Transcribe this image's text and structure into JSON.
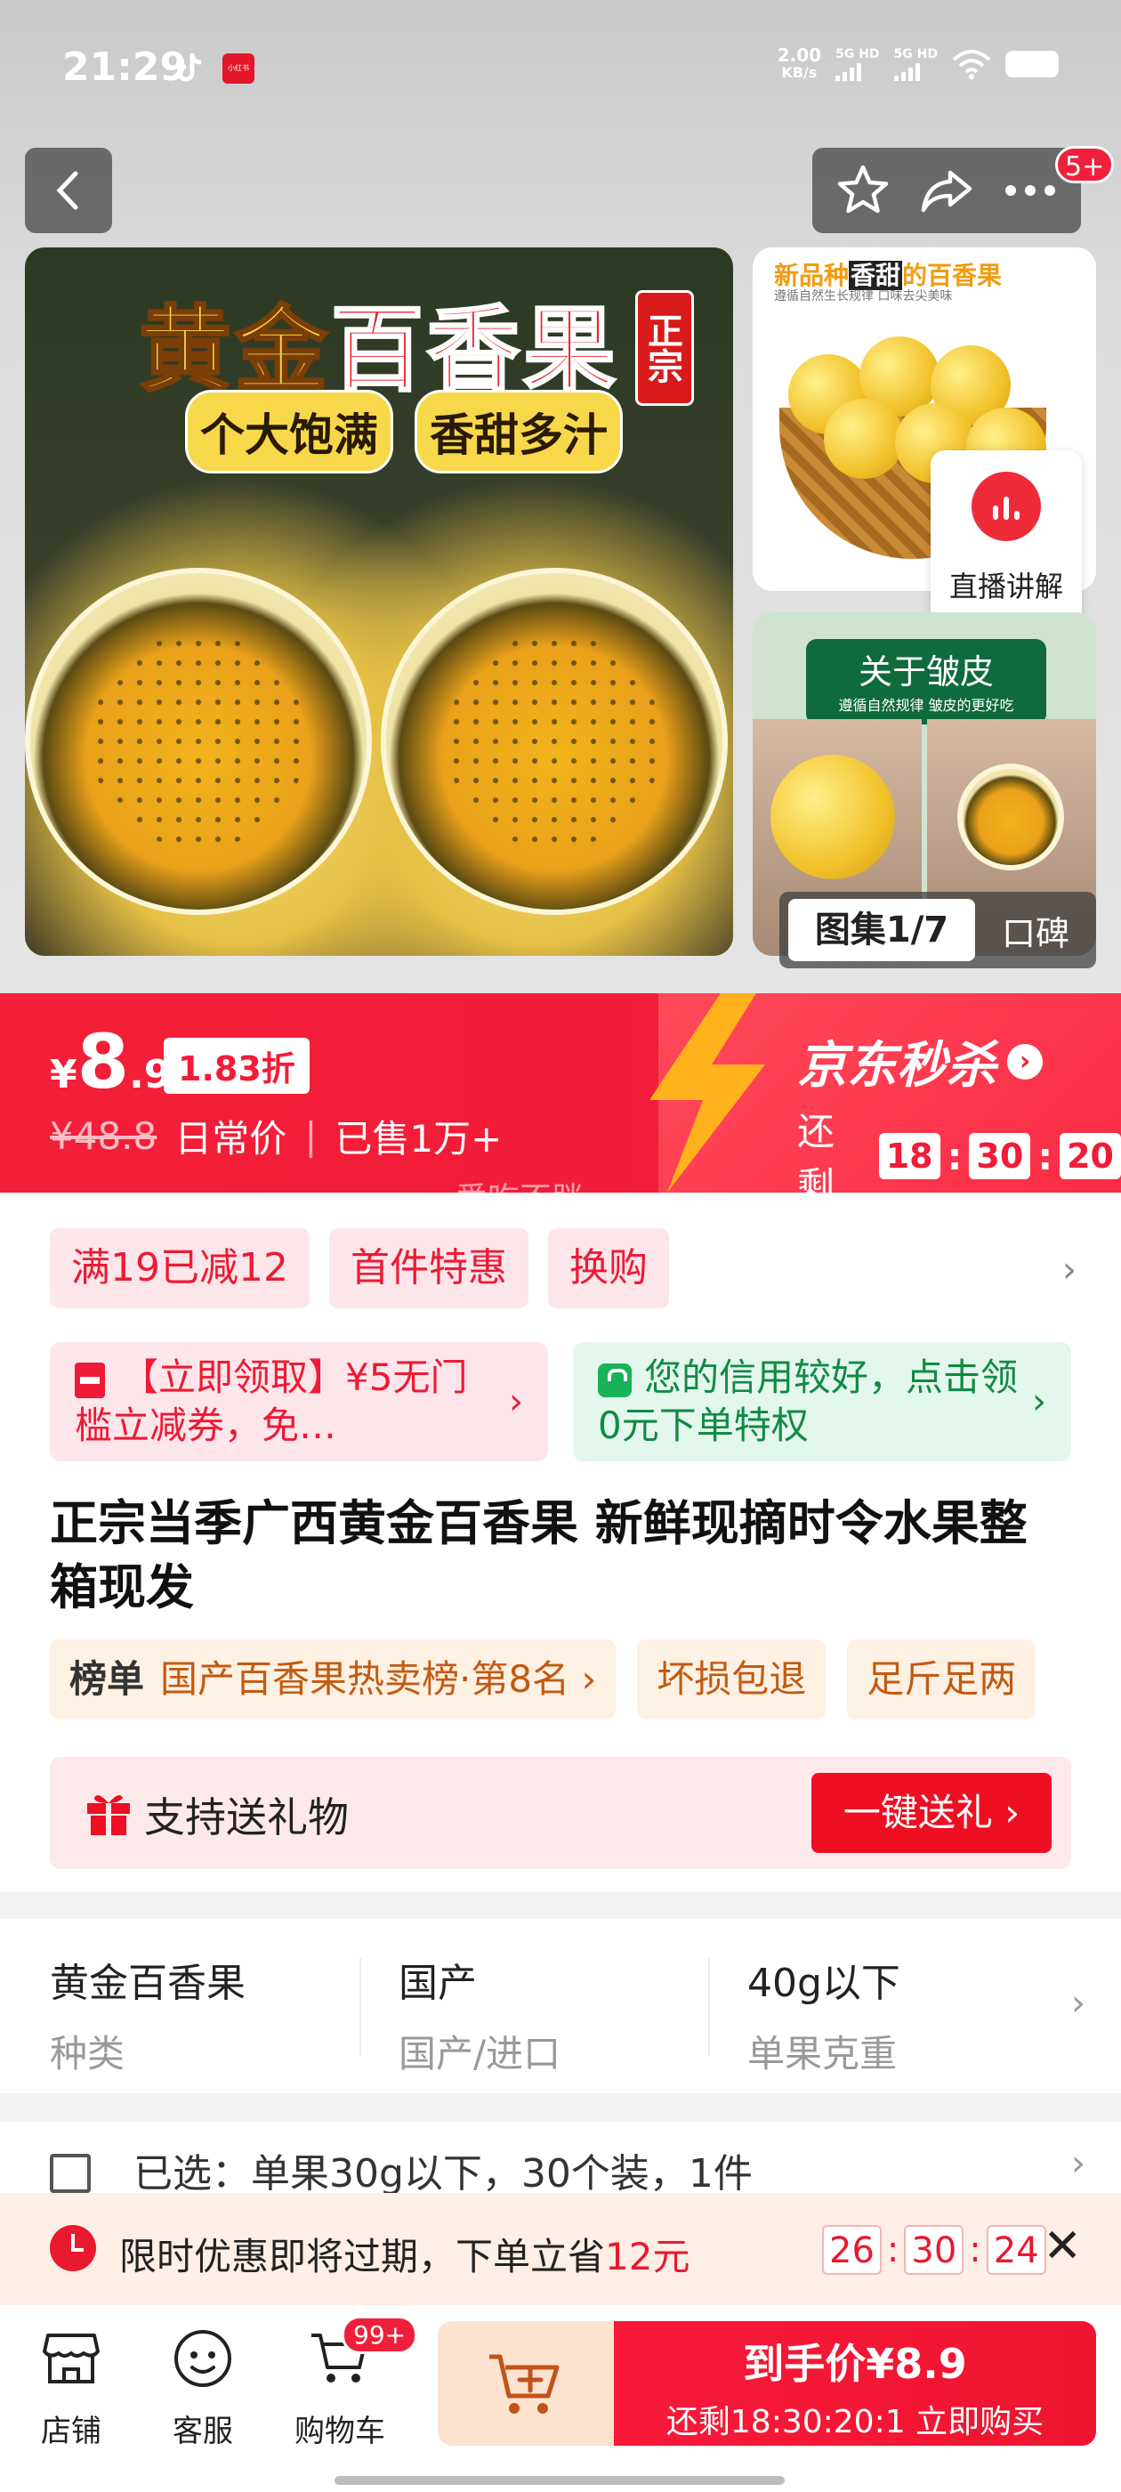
{
  "status_bar": {
    "time": "21:29",
    "net_speed_value": "2.00",
    "net_speed_unit": "KB/s",
    "sim1": "5G HD",
    "sim2": "5G HD",
    "app2_label": "小红书"
  },
  "header": {
    "more_badge": "5+"
  },
  "gallery": {
    "main_title_gold": "黄金",
    "main_title_red": "百香果",
    "main_tag": "正宗",
    "main_sub1": "个大饱满",
    "main_sub2": "香甜多汁",
    "thumb1_title_a": "新品种",
    "thumb1_title_b": "香甜",
    "thumb1_title_c": "的百香果",
    "thumb1_sub": "遵循自然生长规律 口味去尖美味",
    "live_label": "直播讲解",
    "thumb2_title": "关于皱皮",
    "thumb2_sub": "遵循自然规律 皱皮的更好吃",
    "indicator": "图集1/7",
    "reviews_tab": "口碑"
  },
  "price": {
    "symbol": "¥",
    "integer": "8",
    "decimal": ".9",
    "discount": "1.83折",
    "original_price": "¥48.8",
    "original_label": "日常价",
    "sold": "已售1万+",
    "seckill_title": "京东秒杀",
    "remaining_label": "还剩",
    "cd_h": "18",
    "cd_m": "30",
    "cd_s": "20",
    "watermark": "爱吃不胖"
  },
  "promotions": {
    "chips": [
      "满19已减12",
      "首件特惠",
      "换购"
    ],
    "coupon_red": "【立即领取】¥5无门槛立减券，免…",
    "coupon_green": "您的信用较好，点击领0元下单特权"
  },
  "product": {
    "title": "正宗当季广西黄金百香果 新鲜现摘时令水果整箱现发",
    "rank_label": "榜单",
    "rank_text": "国产百香果热卖榜·第8名 ›",
    "tag2": "坏损包退",
    "tag3": "足斤足两",
    "gift_label": "支持送礼物",
    "gift_button": "一键送礼 ›"
  },
  "specs": [
    {
      "value": "黄金百香果",
      "key": "种类"
    },
    {
      "value": "国产",
      "key": "国产/进口"
    },
    {
      "value": "40g以下",
      "key": "单果克重"
    }
  ],
  "selection": {
    "text": "已选：单果30g以下，30个装，1件"
  },
  "expire_bar": {
    "text": "限时优惠即将过期，下单立省",
    "amount": "12元",
    "h": "26",
    "m": "30",
    "s": "24"
  },
  "bottom_bar": {
    "store": "店铺",
    "service": "客服",
    "cart": "购物车",
    "cart_badge": "99+",
    "buy_price": "到手价¥8.9",
    "buy_sub": "还剩18:30:20:1 立即购买"
  },
  "colors": {
    "brand_red": "#f21c38",
    "coupon_green": "#118a45",
    "rank_orange": "#c35a10"
  }
}
